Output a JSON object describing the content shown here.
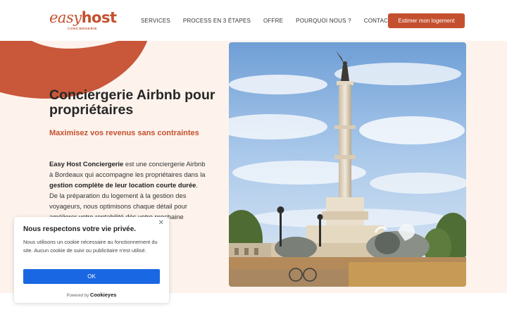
{
  "brand": {
    "logo_easy": "easy",
    "logo_host": "host",
    "logo_sub": "CONCIERGERIE",
    "accent_color": "#c4502f"
  },
  "nav": {
    "items": [
      "SERVICES",
      "PROCESS EN 3 ÉTAPES",
      "OFFRE",
      "POURQUOI NOUS ?",
      "CONTACT"
    ],
    "cta_label": "Estimer mon logement"
  },
  "hero": {
    "title": "Conciergerie Airbnb pour propriétaires",
    "subtitle": "Maximisez vos revenus sans contraintes",
    "body": {
      "p1": "Easy Host Conciergerie",
      "p2": " est une conciergerie Airbnb à Bordeaux qui accompagne les propriétaires dans la ",
      "p3": "gestion complète de leur location courte durée",
      "p4": ". De la préparation du logement à la gestion des voyageurs, nous optimisons chaque détail pour améliorer votre rentabilité dès votre prochaine réservation prochable."
    },
    "background_color": "#fdf3ec"
  },
  "cookie_banner": {
    "title": "Nous respectons votre vie privée.",
    "text": "Nous utilisons un cookie nécessaire au fonctionnement du site. Aucun cookie de suivi ou publicitaire n'est utilisé.",
    "ok_label": "OK",
    "powered_by": "Powered by",
    "powered_brand": "Cookieyes",
    "close_icon": "close-icon",
    "button_color": "#1a67e3"
  }
}
